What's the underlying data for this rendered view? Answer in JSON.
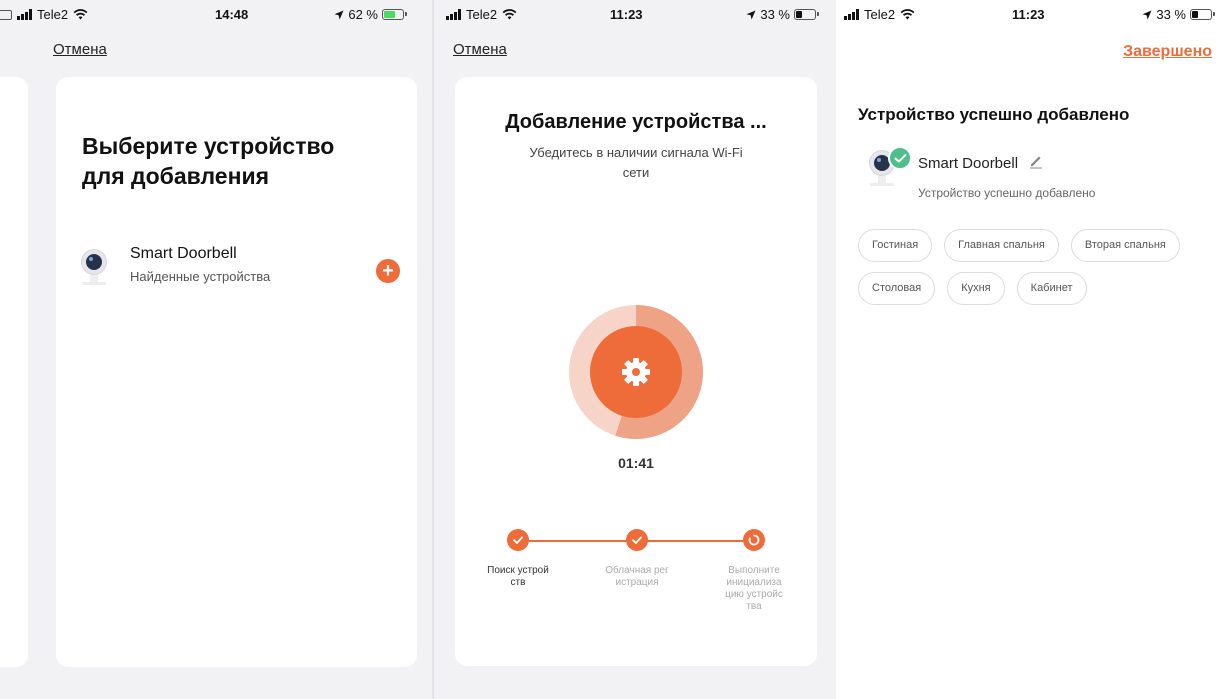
{
  "colors": {
    "accent": "#ee6b3a",
    "success": "#4cbf8a",
    "background": "#f2f2f5"
  },
  "screen1": {
    "status": {
      "carrier": "Tele2",
      "time": "14:48",
      "battery": "62 %",
      "battery_level": 0.62
    },
    "cancel_label": "Отмена",
    "title": "Выберите устройство для добавления",
    "device": {
      "name": "Smart Doorbell",
      "subtitle": "Найденные устройства",
      "add_icon": "plus-circle-icon",
      "device_icon": "camera-icon"
    }
  },
  "screen2": {
    "status": {
      "carrier": "Tele2",
      "time": "11:23",
      "battery": "33 %",
      "battery_level": 0.33
    },
    "cancel_label": "Отмена",
    "title": "Добавление устройства ...",
    "subtitle": "Убедитесь в наличии сигнала Wi-Fi сети",
    "center_icon": "gear-icon",
    "progress": 0.55,
    "timer": "01:41",
    "steps": [
      {
        "label": "Поиск устройств",
        "state": "done"
      },
      {
        "label": "Облачная регистрация",
        "state": "done"
      },
      {
        "label": "Выполните инициализацию устройства",
        "state": "in-progress"
      }
    ]
  },
  "screen3": {
    "status": {
      "carrier": "Tele2",
      "time": "11:23",
      "battery": "33 %",
      "battery_level": 0.33
    },
    "done_label": "Завершено",
    "title": "Устройство успешно добавлено",
    "device": {
      "name": "Smart Doorbell",
      "subtitle": "Устройство успешно добавлено",
      "edit_icon": "pencil-icon"
    },
    "rooms": [
      "Гостиная",
      "Главная спальня",
      "Вторая спальня",
      "Столовая",
      "Кухня",
      "Кабинет"
    ]
  }
}
